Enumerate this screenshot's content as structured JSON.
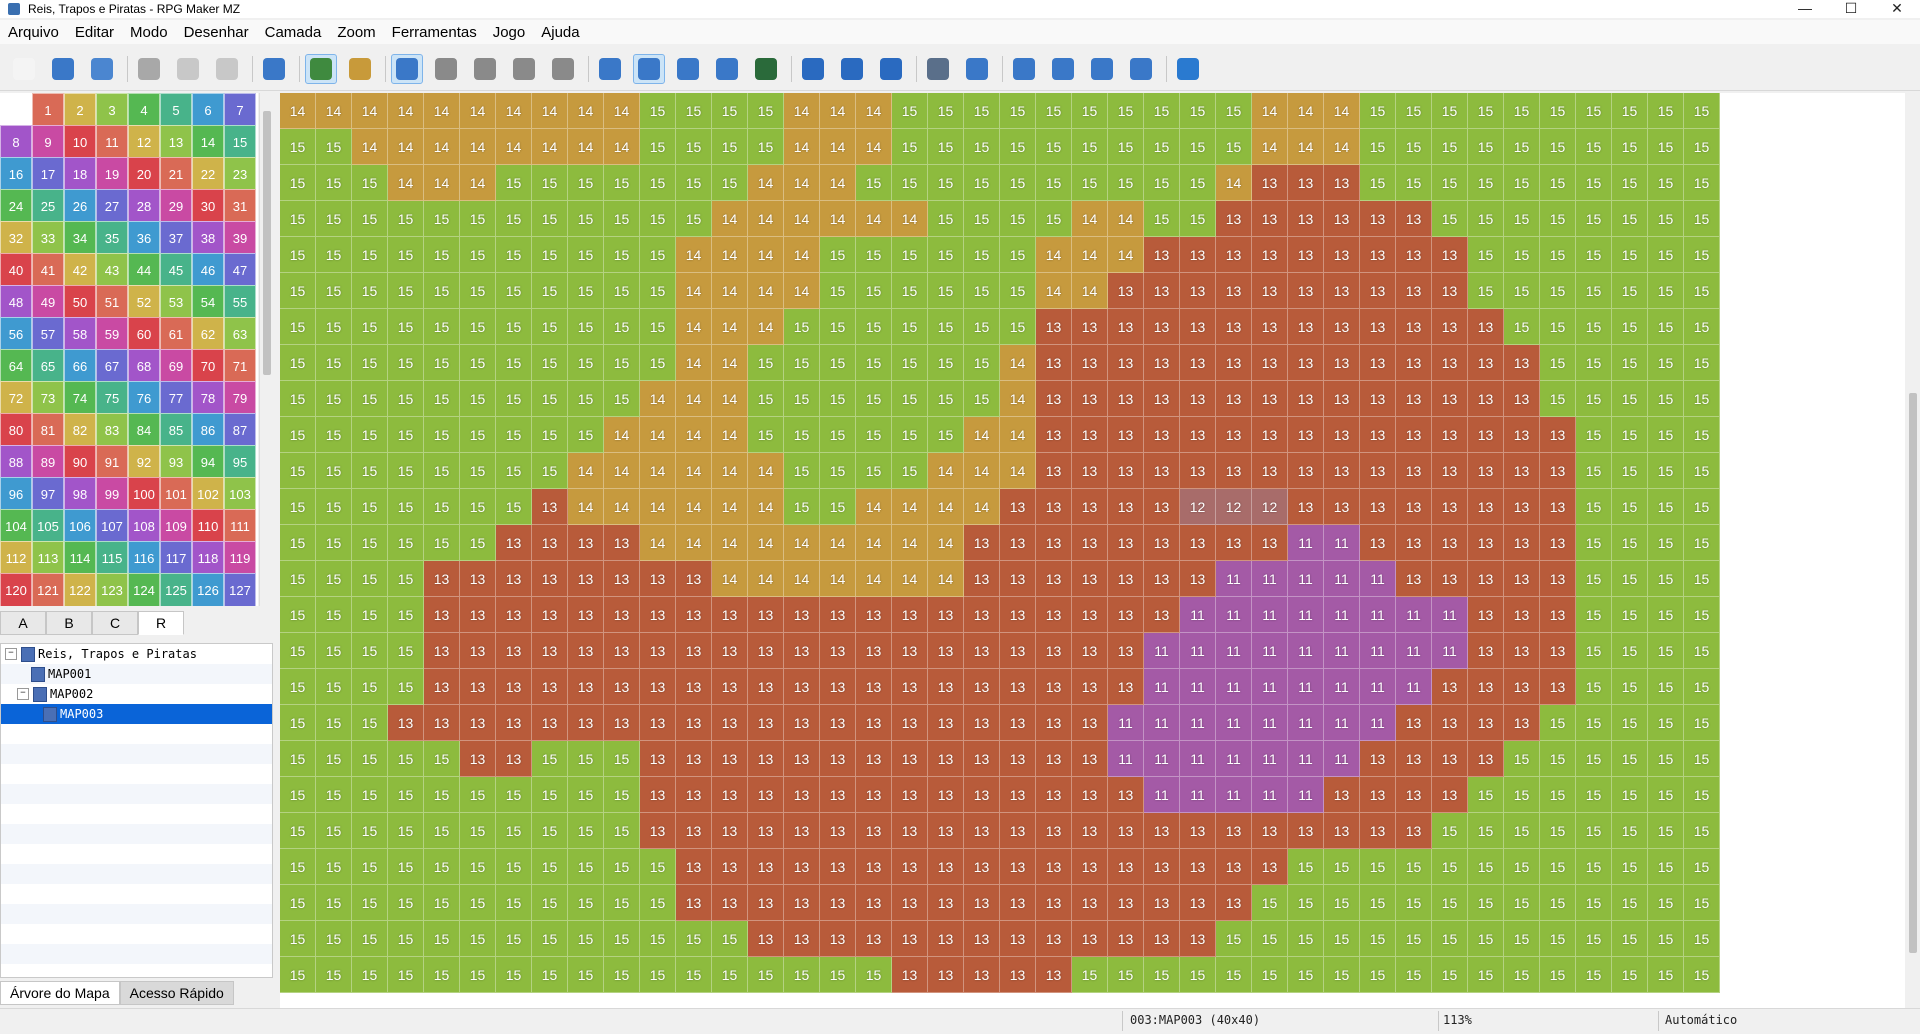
{
  "window": {
    "title": "Reis, Trapos e Piratas - RPG Maker MZ",
    "minimize": "—",
    "maximize": "☐",
    "close": "✕"
  },
  "menu": [
    "Arquivo",
    "Editar",
    "Modo",
    "Desenhar",
    "Camada",
    "Zoom",
    "Ferramentas",
    "Jogo",
    "Ajuda"
  ],
  "toolbar": [
    {
      "name": "new-project-icon",
      "color": "#f4f4f4",
      "active": false
    },
    {
      "name": "open-project-icon",
      "color": "#3a78c8",
      "active": false
    },
    {
      "name": "save-project-icon",
      "color": "#4b86d0",
      "active": false
    },
    {
      "sep": true
    },
    {
      "name": "cut-icon",
      "color": "#a8a8a8",
      "active": false
    },
    {
      "name": "copy-icon",
      "color": "#c8c8c8",
      "active": false
    },
    {
      "name": "paste-icon",
      "color": "#c8c8c8",
      "active": false
    },
    {
      "sep": true
    },
    {
      "name": "undo-icon",
      "color": "#3a78c8",
      "active": false
    },
    {
      "sep": true
    },
    {
      "name": "map-mode-icon",
      "color": "#3f8a3f",
      "active": true
    },
    {
      "name": "event-mode-icon",
      "color": "#c89a3a",
      "active": false
    },
    {
      "sep": true
    },
    {
      "name": "layer-1-icon",
      "color": "#3a78c8",
      "active": true
    },
    {
      "name": "layer-2-icon",
      "color": "#8a8a8a",
      "active": false
    },
    {
      "name": "layer-3-icon",
      "color": "#8a8a8a",
      "active": false
    },
    {
      "name": "layer-4-icon",
      "color": "#8a8a8a",
      "active": false
    },
    {
      "name": "all-layers-icon",
      "color": "#8a8a8a",
      "active": false
    },
    {
      "sep": true
    },
    {
      "name": "pencil-icon",
      "color": "#3a78c8",
      "active": false
    },
    {
      "name": "rectangle-icon",
      "color": "#3a78c8",
      "active": true
    },
    {
      "name": "ellipse-icon",
      "color": "#3a78c8",
      "active": false
    },
    {
      "name": "flood-fill-icon",
      "color": "#3a78c8",
      "active": false
    },
    {
      "name": "shadow-pen-icon",
      "color": "#2a6a3a",
      "active": false
    },
    {
      "sep": true
    },
    {
      "name": "zoom-in-icon",
      "color": "#2a6ac0",
      "active": false
    },
    {
      "name": "zoom-out-icon",
      "color": "#2a6ac0",
      "active": false
    },
    {
      "name": "zoom-actual-icon",
      "color": "#2a6ac0",
      "active": false
    },
    {
      "sep": true
    },
    {
      "name": "database-icon",
      "color": "#5a6f8a",
      "active": false
    },
    {
      "name": "plugin-manager-icon",
      "color": "#3a78c8",
      "active": false
    },
    {
      "sep": true
    },
    {
      "name": "sound-test-icon",
      "color": "#3a78c8",
      "active": false
    },
    {
      "name": "event-searcher-icon",
      "color": "#3a78c8",
      "active": false
    },
    {
      "name": "resource-manager-icon",
      "color": "#3a78c8",
      "active": false
    },
    {
      "name": "character-generator-icon",
      "color": "#3a78c8",
      "active": false
    },
    {
      "sep": true
    },
    {
      "name": "playtest-icon",
      "color": "#2a7ad0",
      "active": false
    }
  ],
  "palette": {
    "rows": [
      [
        "",
        "1",
        "2",
        "3",
        "4",
        "5",
        "6",
        "7"
      ],
      [
        "8",
        "9",
        "10",
        "11",
        "12",
        "13",
        "14",
        "15"
      ],
      [
        "16",
        "17",
        "18",
        "19",
        "20",
        "21",
        "22",
        "23"
      ],
      [
        "24",
        "25",
        "26",
        "27",
        "28",
        "29",
        "30",
        "31"
      ],
      [
        "32",
        "33",
        "34",
        "35",
        "36",
        "37",
        "38",
        "39"
      ],
      [
        "40",
        "41",
        "42",
        "43",
        "44",
        "45",
        "46",
        "47"
      ],
      [
        "48",
        "49",
        "50",
        "51",
        "52",
        "53",
        "54",
        "55"
      ],
      [
        "56",
        "57",
        "58",
        "59",
        "60",
        "61",
        "62",
        "63"
      ],
      [
        "64",
        "65",
        "66",
        "67",
        "68",
        "69",
        "70",
        "71"
      ],
      [
        "72",
        "73",
        "74",
        "75",
        "76",
        "77",
        "78",
        "79"
      ],
      [
        "80",
        "81",
        "82",
        "83",
        "84",
        "85",
        "86",
        "87"
      ],
      [
        "88",
        "89",
        "90",
        "91",
        "92",
        "93",
        "94",
        "95"
      ],
      [
        "96",
        "97",
        "98",
        "99",
        "100",
        "101",
        "102",
        "103"
      ],
      [
        "104",
        "105",
        "106",
        "107",
        "108",
        "109",
        "110",
        "111"
      ],
      [
        "112",
        "113",
        "114",
        "115",
        "116",
        "117",
        "118",
        "119"
      ],
      [
        "120",
        "121",
        "122",
        "123",
        "124",
        "125",
        "126",
        "127"
      ]
    ],
    "colors": [
      "#d9434b",
      "#d96a56",
      "#cfb34a",
      "#8fc34a",
      "#55b852",
      "#48b38a",
      "#3f9ad0",
      "#6a6ad0",
      "#a255c9",
      "#c94aa3"
    ]
  },
  "tileset_tabs": [
    "A",
    "B",
    "C",
    "R"
  ],
  "tileset_tab_selected": "R",
  "map_tree": [
    {
      "label": "Reis, Trapos e Piratas",
      "level": 0,
      "expander": "⊟",
      "kind": "project",
      "selected": false
    },
    {
      "label": "MAP001",
      "level": 1,
      "expander": "",
      "kind": "map",
      "selected": false
    },
    {
      "label": "MAP002",
      "level": 1,
      "expander": "⊟",
      "kind": "map",
      "selected": false
    },
    {
      "label": "MAP003",
      "level": 2,
      "expander": "",
      "kind": "map",
      "selected": true
    }
  ],
  "bottom_tabs": [
    "Árvore do Mapa",
    "Acesso Rápido"
  ],
  "bottom_tab_selected": "Árvore do Mapa",
  "map": {
    "region_colors": {
      "15": "#8dbb3e",
      "14": "#c69a3e",
      "13": "#b85b3a",
      "12": "#a86c6a",
      "11": "#a45aa6"
    },
    "boxed_value": "13",
    "grid": [
      "14 14 14 14 14 14 14 14 14 14 15 15 15 15 14 14 14 15 15 15 15 15 15 15 15 15 15 14 14 14 15 15 15 15 15 15 15 15 15 15",
      "15 15 14 14 14 14 14 14 14 14 15 15 15 15 14 14 14 15 15 15 15 15 15 15 15 15 15 14 14 14 15 15 15 15 15 15 15 15 15 15",
      "15 15 15 14 14 14 15 15 15 15 15 15 15 14 14 14 15 15 15 15 15 15 15 15 15 15 14 13 13 13 15 15 15 15 15 15 15 15 15 15",
      "15 15 15 15 15 15 15 15 15 15 15 15 14 14 14 14 14 14 15 15 15 15 14 14 15 15 13 13 13 13 13 13 15 15 15 15 15 15 15 15",
      "15 15 15 15 15 15 15 15 15 15 15 14 14 14 14 15 15 15 15 15 15 14 14 14 13 13 13 13 13 13 13 13 13 15 15 15 15 15 15 15",
      "15 15 15 15 15 15 15 15 15 15 15 14 14 14 14 15 15 15 15 15 15 14 14 13 13 13 13 13 13 13 13 13 13 15 15 15 15 15 15 15",
      "15 15 15 15 15 15 15 15 15 15 15 14 14 14 15 15 15 15 15 15 15 13 13 13 13 13 13 13 13 13 13 13 13 13 15 15 15 15 15 15",
      "15 15 15 15 15 15 15 15 15 15 15 14 14 15 15 15 15 15 15 15 14 13 13 13 13 13 13 13 13 13 13 13 13 13 13 15 15 15 15 15",
      "15 15 15 15 15 15 15 15 15 15 14 14 14 15 15 15 15 15 15 15 14 13 13 13 13 13 13 13 13 13 13 13 13 13 13 15 15 15 15 15",
      "15 15 15 15 15 15 15 15 15 14 14 14 14 15 15 15 15 15 15 14 14 13 13 13 13 13 13 13 13 13 13 13 13 13 13 13 15 15 15 15",
      "15 15 15 15 15 15 15 15 14 14 14 14 14 14 15 15 15 15 14 14 14 13 13 13 13 13 13 13 13 13 13 13 13 13 13 13 15 15 15 15",
      "15 15 15 15 15 15 15 13 14 14 14 14 14 14 15 15 14 14 14 14 13 13 13 13 13 12 12 12 13 13 13 13 13 13 13 13 15 15 15 15",
      "15 15 15 15 15 15 13 13 13 13 14 14 14 14 14 14 14 14 14 13 13 13 13 13 13 13 13 13 11 11 13 13 13 13 13 13 15 15 15 15",
      "15 15 15 15 13 13 13 13 13 13 13 13 14 14 14 14 14 14 14 13 13 13 13 13 13 13 11 11 11 11 11 13 13 13 13 13 15 15 15 15",
      "15 15 15 15 13 13 13 13 13 13 13 13 13 13 13 13 13 13 13 13 13 13 13 13 13 11 11 11 11 11 11 11 11 13 13 13 15 15 15 15",
      "15 15 15 15 13 13 13 13 13 13 13 13 13 13 13 13 13 13 13 13 13 13 13 13 11 11 11 11 11 11 11 11 11 13 13 13 15 15 15 15",
      "15 15 15 15 13 13 13 13 13 13 13 13 13 13 13 13 13 13 13 13 13 13 13 13 11 11 11 11 11 11 11 11 13 13 13 13 15 15 15 15",
      "15 15 15 13 13 13 13 13 13 13 13 13 13 13 13 13 13 13 13 13 13 13 13 11 11 11 11 11 11 11 11 13 13 13 13 15 15 15 15 15",
      "15 15 15 15 15 13 13 15 15 15 13 13 13 13 13 13 13 13 13 13 13 13 13 11 11 11 11 11 11 11 13 13 13 13 15 15 15 15 15 15",
      "15 15 15 15 15 15 15 15 15 15 13 13 13 13 13 13 13 13 13 13 13 13 13 13 11 11 11 11 11 13 13 13 13 15 15 15 15 15 15 15",
      "15 15 15 15 15 15 15 15 15 15 13 13 13 13 13 13 13 13 13 13 13 13 13 13 13 13 13 13 13 13 13 13 15 15 15 15 15 15 15 15",
      "15 15 15 15 15 15 15 15 15 15 15 13 13 13 13 13 13 13 13 13 13 13 13 13 13 13 13 13 15 15 15 15 15 15 15 15 15 15 15 15",
      "15 15 15 15 15 15 15 15 15 15 15 13 13 13 13 13 13 13 13 13 13 13 13 13 13 13 13 15 15 15 15 15 15 15 15 15 15 15 15 15",
      "15 15 15 15 15 15 15 15 15 15 15 15 15 13 13 13 13 13 13 13 13 13 13 13 13 13 15 15 15 15 15 15 15 15 15 15 15 15 15 15",
      "15 15 15 15 15 15 15 15 15 15 15 15 15 15 15 15 15 13 13 13 13 13 15 15 15 15 15 15 15 15 15 15 15 15 15 15 15 15 15 15"
    ]
  },
  "status": {
    "map_info": "003:MAP003 (40x40)",
    "zoom": "113%",
    "mode": "Automático"
  }
}
